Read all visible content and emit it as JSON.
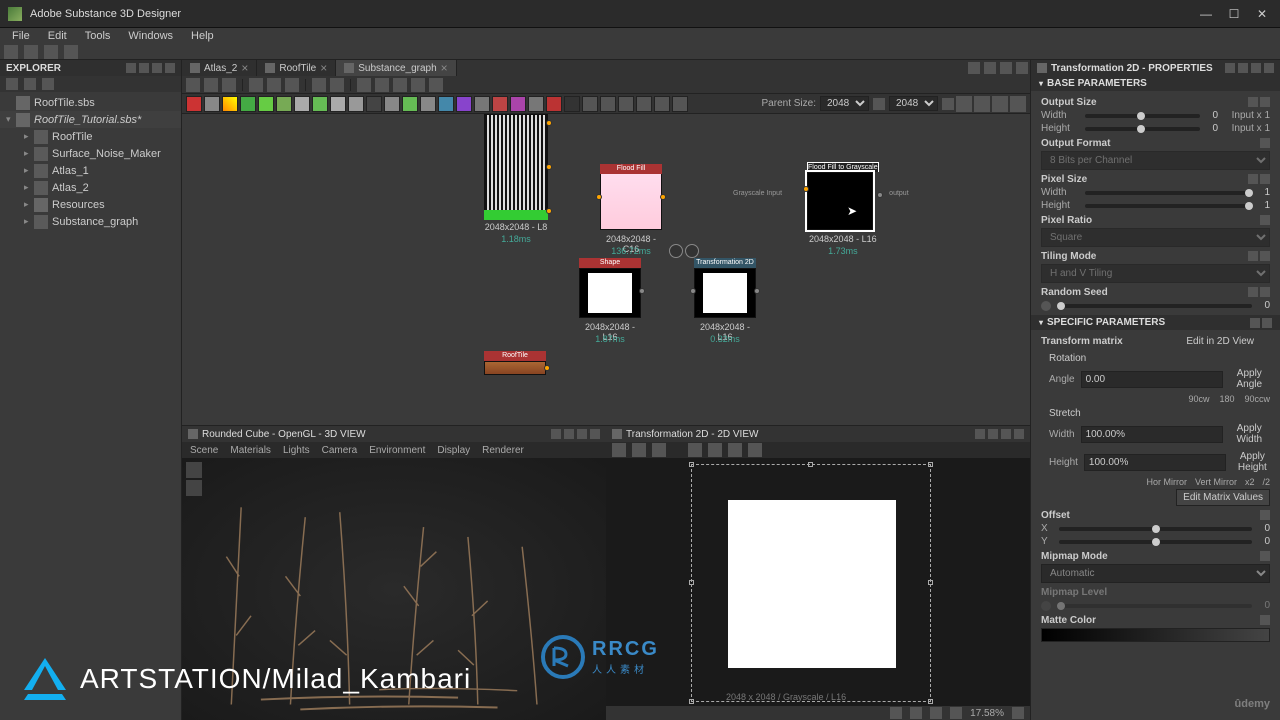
{
  "app": {
    "title": "Adobe Substance 3D Designer"
  },
  "window_buttons": {
    "min": "—",
    "max": "☐",
    "close": "✕"
  },
  "menubar": [
    "File",
    "Edit",
    "Tools",
    "Windows",
    "Help"
  ],
  "explorer": {
    "title": "EXPLORER",
    "items": [
      {
        "label": "RoofTile.sbs",
        "indent": "root",
        "arrow": ""
      },
      {
        "label": "RoofTile_Tutorial.sbs*",
        "indent": "root",
        "arrow": "▾"
      },
      {
        "label": "RoofTile",
        "indent": "child",
        "arrow": "▸"
      },
      {
        "label": "Surface_Noise_Maker",
        "indent": "child",
        "arrow": "▸"
      },
      {
        "label": "Atlas_1",
        "indent": "child",
        "arrow": "▸"
      },
      {
        "label": "Atlas_2",
        "indent": "child",
        "arrow": "▸"
      },
      {
        "label": "Resources",
        "indent": "child",
        "arrow": "▸"
      },
      {
        "label": "Substance_graph",
        "indent": "child",
        "arrow": "▸"
      }
    ]
  },
  "graph": {
    "tabs": [
      {
        "label": "Atlas_2",
        "active": false
      },
      {
        "label": "RoofTile",
        "active": false
      },
      {
        "label": "Substance_graph",
        "active": true
      }
    ],
    "parent_size_label": "Parent Size:",
    "parent_size": "2048",
    "link_size": "2048",
    "nodes": {
      "noise": {
        "info": "2048x2048 - L8",
        "time": "1.18ms"
      },
      "floodfill": {
        "title": "Flood Fill",
        "info": "2048x2048 - C16",
        "time": "136.72ms"
      },
      "ff2gray": {
        "title": "Flood Fill to Grayscale",
        "info": "2048x2048 - L16",
        "time": "1.73ms",
        "port_label": "Grayscale Input",
        "out_label": "output"
      },
      "shape": {
        "title": "Shape",
        "info": "2048x2048 - L16",
        "time": "1.87ms"
      },
      "transform2d": {
        "title": "Transformation 2D",
        "info": "2048x2048 - L16",
        "time": "0.32ms"
      },
      "rooftile": {
        "title": "RoofTile"
      }
    }
  },
  "view3d": {
    "title": "Rounded Cube - OpenGL - 3D VIEW",
    "menu": [
      "Scene",
      "Materials",
      "Lights",
      "Camera",
      "Environment",
      "Display",
      "Renderer"
    ]
  },
  "view2d": {
    "title": "Transformation 2D - 2D VIEW",
    "zoom": "17.58%",
    "footer_info": "2048 x 2048 / Grayscale / L16"
  },
  "properties": {
    "title": "Transformation 2D - PROPERTIES",
    "sections": {
      "base": "BASE PARAMETERS",
      "specific": "SPECIFIC PARAMETERS"
    },
    "output_size": {
      "label": "Output Size",
      "width_label": "Width",
      "width_val": "0",
      "width_suffix": "Input x 1",
      "height_label": "Height",
      "height_val": "0",
      "height_suffix": "Input x 1"
    },
    "output_format": {
      "label": "Output Format",
      "value": "8 Bits per Channel"
    },
    "pixel_size": {
      "label": "Pixel Size",
      "width_label": "Width",
      "width_val": "1",
      "height_label": "Height",
      "height_val": "1"
    },
    "pixel_ratio": {
      "label": "Pixel Ratio",
      "value": "Square"
    },
    "tiling_mode": {
      "label": "Tiling Mode",
      "value": "H and V Tiling"
    },
    "random_seed": {
      "label": "Random Seed",
      "value": "0"
    },
    "transform_matrix": {
      "label": "Transform matrix",
      "button": "Edit in 2D View"
    },
    "rotation": {
      "label": "Rotation",
      "angle_label": "Angle",
      "angle": "0.00",
      "apply": "Apply Angle",
      "presets": [
        "90cw",
        "180",
        "90ccw"
      ]
    },
    "stretch": {
      "label": "Stretch",
      "width_label": "Width",
      "width": "100.00%",
      "apply_w": "Apply Width",
      "height_label": "Height",
      "height": "100.00%",
      "apply_h": "Apply Height",
      "mirror_h": "Hor Mirror",
      "mirror_v": "Vert Mirror",
      "x2": "x2",
      "div2": "/2",
      "edit_btn": "Edit Matrix Values"
    },
    "offset": {
      "label": "Offset",
      "x_label": "X",
      "x_val": "0",
      "y_label": "Y",
      "y_val": "0"
    },
    "mipmap_mode": {
      "label": "Mipmap Mode",
      "value": "Automatic"
    },
    "mipmap_level": {
      "label": "Mipmap Level",
      "value": "0"
    },
    "matte_color": {
      "label": "Matte Color"
    }
  },
  "watermark": {
    "text": "ARTSTATION/Milad_Kambari",
    "rrcg": "RRCG",
    "rrcg_sub": "人人素材",
    "udemy": "ûdemy"
  }
}
